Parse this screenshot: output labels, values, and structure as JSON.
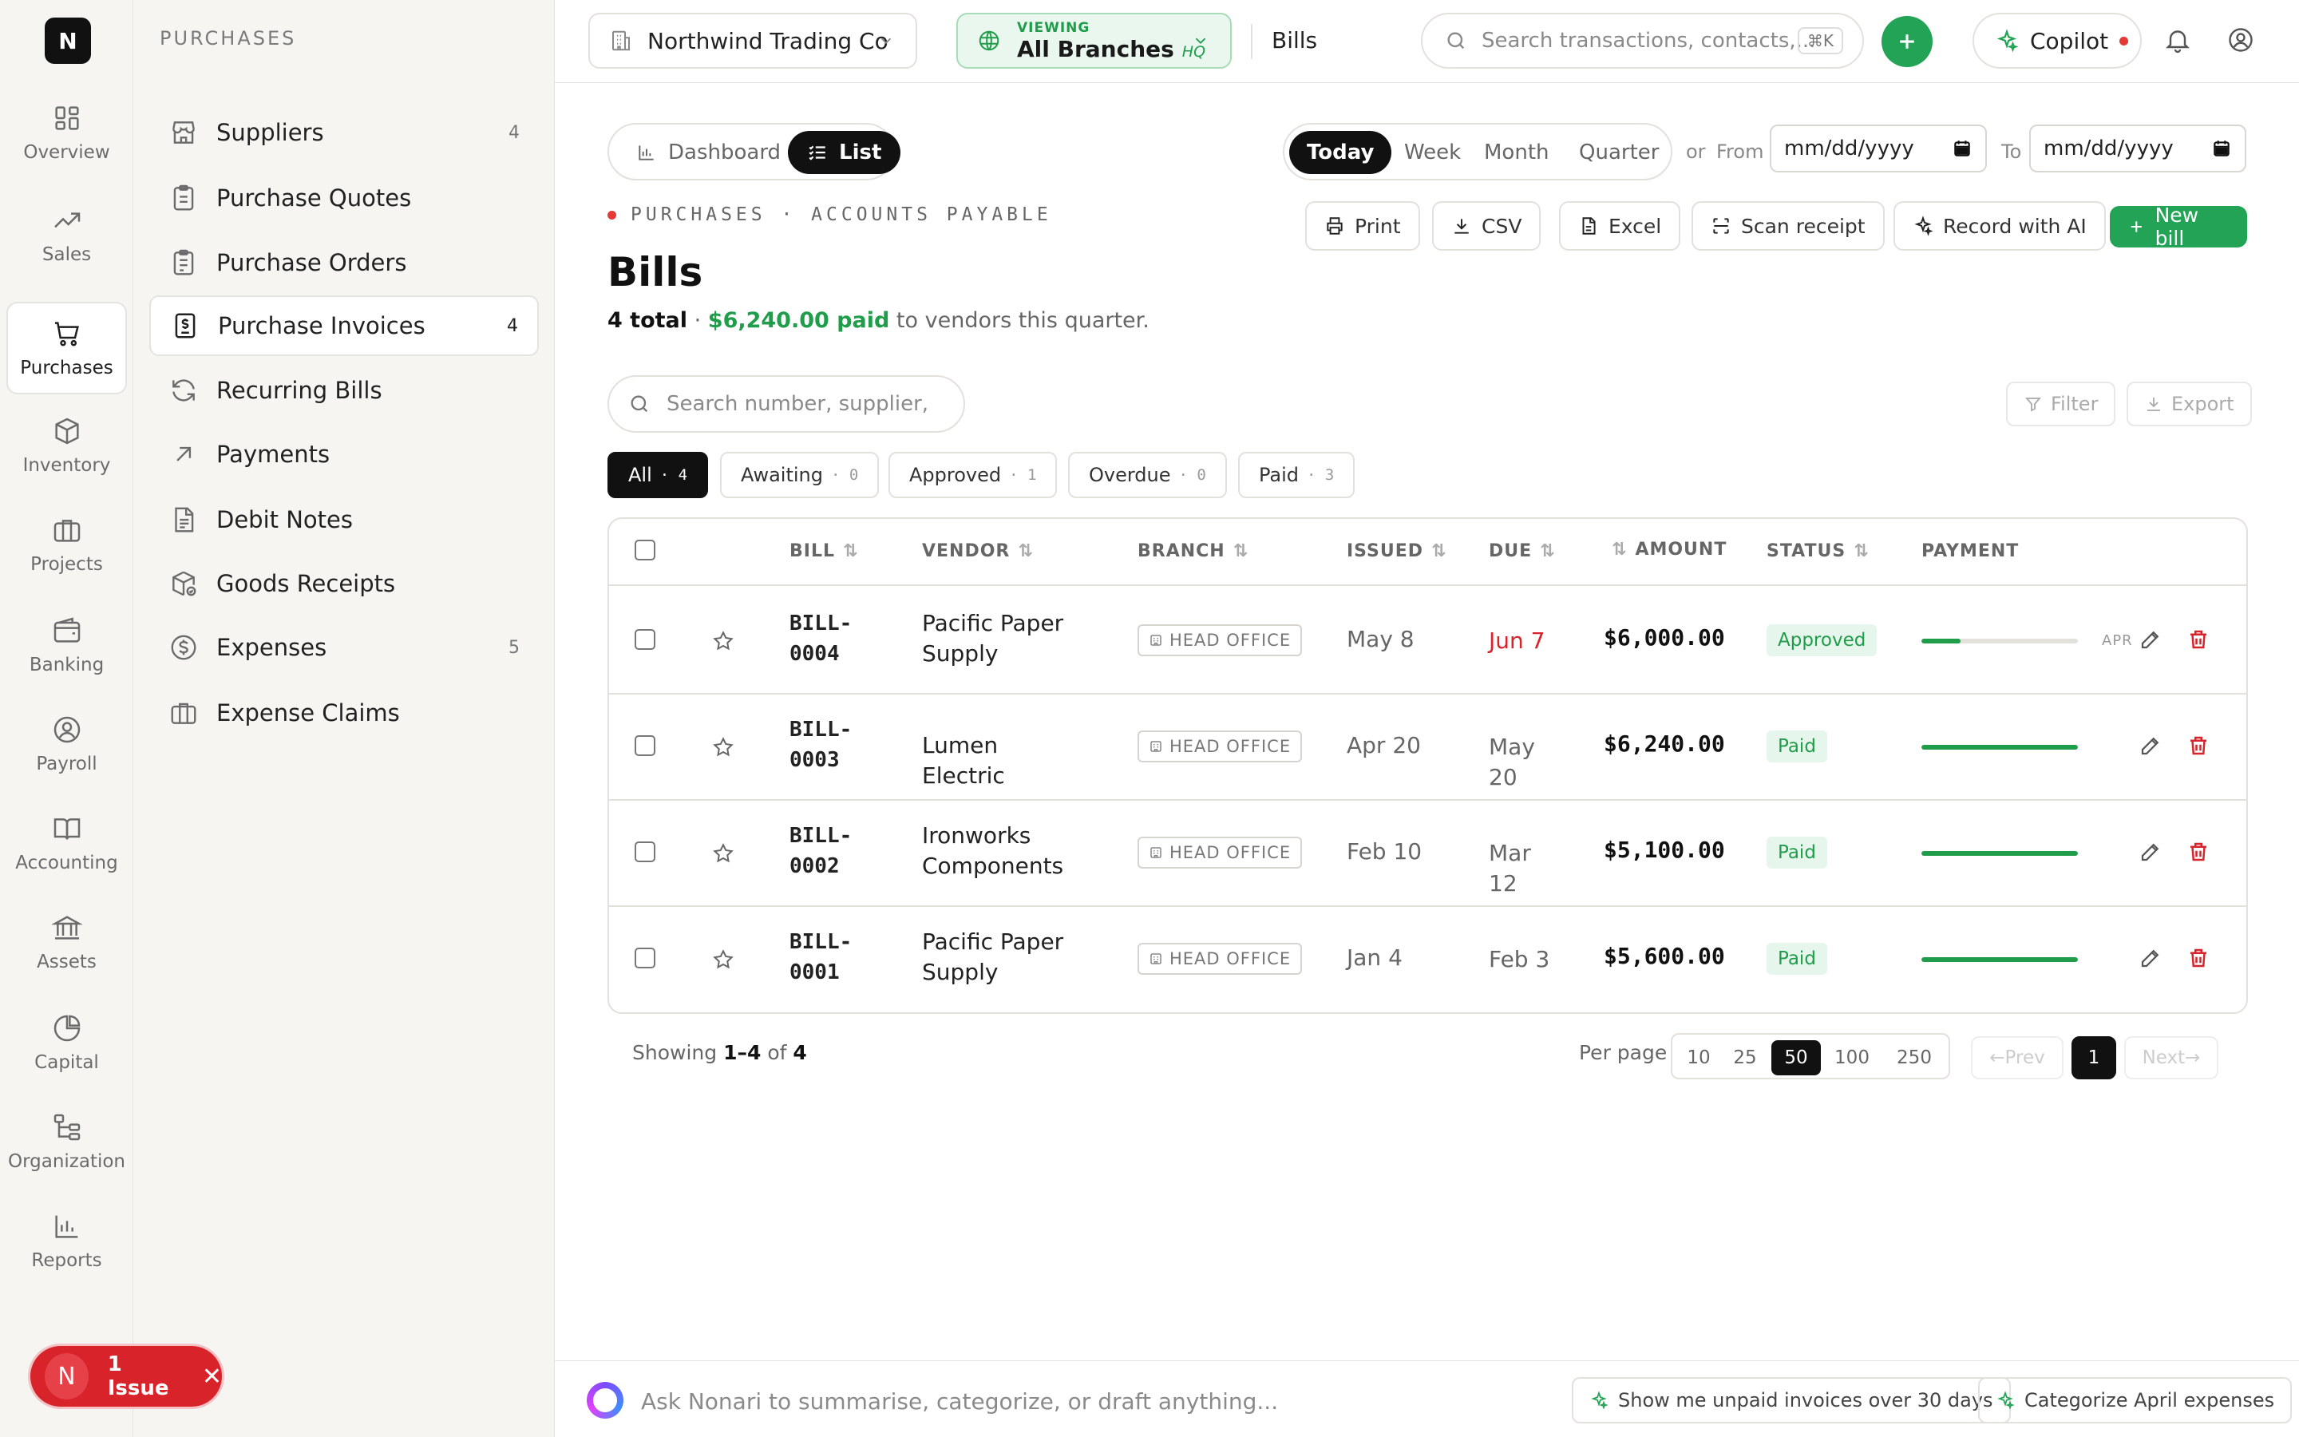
{
  "app": {
    "logo_letter": "N"
  },
  "rail": [
    {
      "label": "Overview",
      "icon": "grid-icon"
    },
    {
      "label": "Sales",
      "icon": "trend-up-icon"
    },
    {
      "label": "Purchases",
      "icon": "cart-icon",
      "active": true
    },
    {
      "label": "Inventory",
      "icon": "box-icon"
    },
    {
      "label": "Projects",
      "icon": "briefcase-icon"
    },
    {
      "label": "Banking",
      "icon": "wallet-icon"
    },
    {
      "label": "Payroll",
      "icon": "user-circle-icon"
    },
    {
      "label": "Accounting",
      "icon": "book-icon"
    },
    {
      "label": "Assets",
      "icon": "bank-icon"
    },
    {
      "label": "Capital",
      "icon": "pie-icon"
    },
    {
      "label": "Organization",
      "icon": "org-icon"
    },
    {
      "label": "Reports",
      "icon": "bar-chart-icon"
    }
  ],
  "subnav": {
    "title": "PURCHASES",
    "items": [
      {
        "label": "Suppliers",
        "count": "4",
        "icon": "store-icon"
      },
      {
        "label": "Purchase Quotes",
        "count": "",
        "icon": "clipboard-icon"
      },
      {
        "label": "Purchase Orders",
        "count": "",
        "icon": "clipboard-list-icon"
      },
      {
        "label": "Purchase Invoices",
        "count": "4",
        "icon": "invoice-dollar-icon",
        "active": true
      },
      {
        "label": "Recurring Bills",
        "count": "",
        "icon": "refresh-icon"
      },
      {
        "label": "Payments",
        "count": "",
        "icon": "arrow-up-right-icon"
      },
      {
        "label": "Debit Notes",
        "count": "",
        "icon": "file-text-icon"
      },
      {
        "label": "Goods Receipts",
        "count": "",
        "icon": "package-check-icon"
      },
      {
        "label": "Expenses",
        "count": "5",
        "icon": "dollar-circle-icon"
      },
      {
        "label": "Expense Claims",
        "count": "",
        "icon": "briefcase-icon"
      }
    ]
  },
  "issue": {
    "avatar": "N",
    "label": "1 Issue"
  },
  "topbar": {
    "org": "Northwind Trading Co",
    "viewing_label": "VIEWING",
    "branch": "All Branches",
    "branch_tag": "HQ",
    "page": "Bills",
    "search_placeholder": "Search transactions, contacts,...",
    "search_kbd": "⌘K",
    "copilot": "Copilot"
  },
  "toolbar": {
    "views": [
      "Dashboard",
      "List"
    ],
    "active_view": "List",
    "periods": [
      "Today",
      "Week",
      "Month",
      "Quarter"
    ],
    "active_period": "Today",
    "or": "or",
    "from": "From",
    "to": "To",
    "date_placeholder": "mm/dd/yyyy"
  },
  "header": {
    "crumb": "PURCHASES · ACCOUNTS PAYABLE",
    "title": "Bills",
    "total": "4 total",
    "sep": " · ",
    "paid": "$6,240.00 paid",
    "rest": " to vendors this quarter."
  },
  "actions": [
    "Print",
    "CSV",
    "Excel",
    "Scan receipt",
    "Record with AI",
    "New bill"
  ],
  "table_search_placeholder": "Search number, supplier,",
  "table_tools": [
    "Filter",
    "Export"
  ],
  "chips": [
    {
      "label": "All",
      "count": "4"
    },
    {
      "label": "Awaiting",
      "count": "0"
    },
    {
      "label": "Approved",
      "count": "1"
    },
    {
      "label": "Overdue",
      "count": "0"
    },
    {
      "label": "Paid",
      "count": "3"
    }
  ],
  "columns": [
    "BILL",
    "VENDOR",
    "BRANCH",
    "ISSUED",
    "DUE",
    "AMOUNT",
    "STATUS",
    "PAYMENT"
  ],
  "bills": [
    {
      "bill_a": "BILL-",
      "bill_b": "0004",
      "vendor": "Pacific Paper Supply",
      "branch": "HEAD OFFICE",
      "issued": "May 8",
      "due": "Jun 7",
      "due_overdue": true,
      "amount": "$6,000.00",
      "status": "Approved",
      "paid_fraction": 0.25,
      "pay_label": "APR"
    },
    {
      "bill_a": "BILL-",
      "bill_b": "0003",
      "vendor": "Lumen Electric",
      "branch": "HEAD OFFICE",
      "issued": "Apr 20",
      "due": "May 20",
      "due_overdue": false,
      "amount": "$6,240.00",
      "status": "Paid",
      "paid_fraction": 1,
      "pay_label": ""
    },
    {
      "bill_a": "BILL-",
      "bill_b": "0002",
      "vendor": "Ironworks Components",
      "branch": "HEAD OFFICE",
      "issued": "Feb 10",
      "due": "Mar 12",
      "due_overdue": false,
      "amount": "$5,100.00",
      "status": "Paid",
      "paid_fraction": 1,
      "pay_label": ""
    },
    {
      "bill_a": "BILL-",
      "bill_b": "0001",
      "vendor": "Pacific Paper Supply",
      "branch": "HEAD OFFICE",
      "issued": "Jan 4",
      "due": "Feb 3",
      "due_overdue": false,
      "amount": "$5,600.00",
      "status": "Paid",
      "paid_fraction": 1,
      "pay_label": ""
    }
  ],
  "pagination": {
    "showing": "Showing",
    "from": "1",
    "dash": "–",
    "to": "4",
    "of": " of ",
    "total": "4",
    "per_page_label": "Per page",
    "per_page_options": [
      "10",
      "25",
      "50",
      "100",
      "250"
    ],
    "per_page_selected": "50",
    "prev": "←Prev",
    "next": "Next→",
    "page": "1"
  },
  "bottom": {
    "ai_placeholder": "Ask Nonari to summarise, categorize, or draft anything...",
    "suggestions": [
      "Show me unpaid invoices over 30 days",
      "Categorize April expenses"
    ]
  },
  "colors": {
    "accent": "#22a355",
    "danger": "#d8232a",
    "dark": "#111111"
  }
}
